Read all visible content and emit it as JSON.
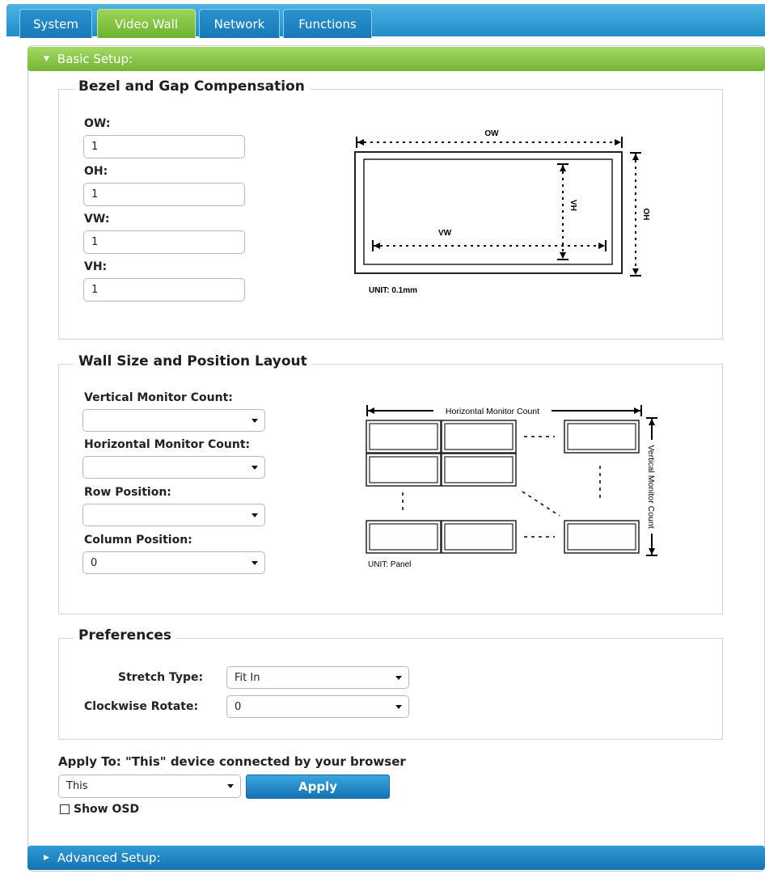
{
  "tabs": [
    {
      "label": "System",
      "active": false
    },
    {
      "label": "Video Wall",
      "active": true
    },
    {
      "label": "Network",
      "active": false
    },
    {
      "label": "Functions",
      "active": false
    }
  ],
  "basic_setup": {
    "title": "Basic Setup:"
  },
  "advanced_setup": {
    "title": "Advanced Setup:"
  },
  "bezel": {
    "legend": "Bezel and Gap Compensation",
    "ow": {
      "label": "OW:",
      "value": "1"
    },
    "oh": {
      "label": "OH:",
      "value": "1"
    },
    "vw": {
      "label": "VW:",
      "value": "1"
    },
    "vh": {
      "label": "VH:",
      "value": "1"
    },
    "diagram": {
      "ow": "OW",
      "oh": "OH",
      "vw": "VW",
      "vh": "VH",
      "unit": "UNIT: 0.1mm"
    }
  },
  "wall": {
    "legend": "Wall Size and Position Layout",
    "vertical_count": {
      "label": "Vertical Monitor Count:",
      "value": ""
    },
    "horizontal_count": {
      "label": "Horizontal Monitor Count:",
      "value": ""
    },
    "row_position": {
      "label": "Row Position:",
      "value": ""
    },
    "column_position": {
      "label": "Column Position:",
      "value": "0"
    },
    "diagram": {
      "horizontal": "Horizontal Monitor Count",
      "vertical": "Vertical Monitor Count",
      "unit": "UNIT: Panel"
    }
  },
  "preferences": {
    "legend": "Preferences",
    "stretch_type": {
      "label": "Stretch Type:",
      "value": "Fit In"
    },
    "clockwise_rotate": {
      "label": "Clockwise Rotate:",
      "value": "0"
    }
  },
  "apply": {
    "label": "Apply To: \"This\" device connected by your browser",
    "target": "This",
    "button": "Apply",
    "show_osd": "Show OSD"
  },
  "colors": {
    "tab_blue": "#1f8cc8",
    "active_green": "#73b533",
    "button_blue": "#1473b3"
  }
}
